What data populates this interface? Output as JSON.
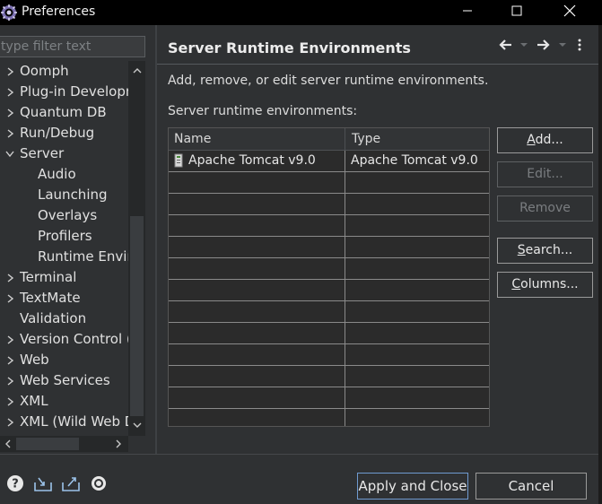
{
  "window": {
    "title": "Preferences"
  },
  "sidebar": {
    "filter_placeholder": "type filter text",
    "items": [
      {
        "label": "Oomph",
        "level": 0,
        "expanded": false
      },
      {
        "label": "Plug-in Development",
        "level": 0,
        "expanded": false
      },
      {
        "label": "Quantum DB",
        "level": 0,
        "expanded": false
      },
      {
        "label": "Run/Debug",
        "level": 0,
        "expanded": false
      },
      {
        "label": "Server",
        "level": 0,
        "expanded": true
      },
      {
        "label": "Audio",
        "level": 1
      },
      {
        "label": "Launching",
        "level": 1
      },
      {
        "label": "Overlays",
        "level": 1
      },
      {
        "label": "Profilers",
        "level": 1
      },
      {
        "label": "Runtime Environments",
        "level": 1
      },
      {
        "label": "Terminal",
        "level": 0,
        "expanded": false
      },
      {
        "label": "TextMate",
        "level": 0,
        "expanded": false
      },
      {
        "label": "Validation",
        "level": 0
      },
      {
        "label": "Version Control (Team)",
        "level": 0,
        "expanded": false
      },
      {
        "label": "Web",
        "level": 0,
        "expanded": false
      },
      {
        "label": "Web Services",
        "level": 0,
        "expanded": false
      },
      {
        "label": "XML",
        "level": 0,
        "expanded": false
      },
      {
        "label": "XML (Wild Web Developer)",
        "level": 0,
        "expanded": false
      }
    ]
  },
  "page": {
    "title": "Server Runtime Environments",
    "description": "Add, remove, or edit server runtime environments.",
    "list_label": "Server runtime environments:",
    "table": {
      "columns": [
        "Name",
        "Type"
      ],
      "rows": [
        {
          "name": "Apache Tomcat v9.0",
          "type": "Apache Tomcat v9.0"
        }
      ]
    },
    "buttons": {
      "add": {
        "mnemonic": "A",
        "rest": "dd..."
      },
      "edit": {
        "label": "Edit..."
      },
      "remove": {
        "label": "Remove"
      },
      "search": {
        "mnemonic": "S",
        "rest": "earch..."
      },
      "columns": {
        "mnemonic": "C",
        "rest": "olumns..."
      }
    }
  },
  "footer": {
    "apply_close": "Apply and Close",
    "cancel": "Cancel"
  },
  "colors": {
    "background": "#2f3133",
    "titlebar": "#000000",
    "accent_border": "#6f9ad0",
    "row_separator": "#8a8a8a"
  }
}
